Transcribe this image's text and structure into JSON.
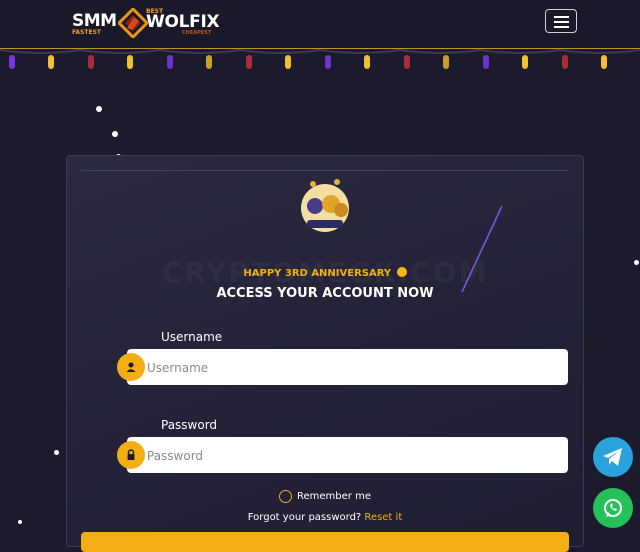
{
  "header": {
    "logo": {
      "smm": "SMM",
      "fastest": "FASTEST",
      "best": "BEST",
      "wolfix": "WOLFIX",
      "cheapest": "CHEAPEST"
    },
    "menu_icon": "hamburger-icon"
  },
  "login": {
    "watermark": "CRYPTOMEGK.COM",
    "anniversary": "HAPPY 3RD ANNIVERSARY",
    "heading": "ACCESS YOUR ACCOUNT NOW",
    "username_label": "Username",
    "username_placeholder": "Username",
    "password_label": "Password",
    "password_placeholder": "Password",
    "remember_label": "Remember me",
    "forgot_text": "Forgot your password?",
    "reset_link": "Reset it"
  },
  "colors": {
    "accent": "#f2ae14",
    "background": "#1c1b2e",
    "telegram": "#2aa3dd",
    "whatsapp": "#25c05a"
  },
  "floating": {
    "telegram_icon": "telegram-icon",
    "whatsapp_icon": "whatsapp-icon"
  }
}
